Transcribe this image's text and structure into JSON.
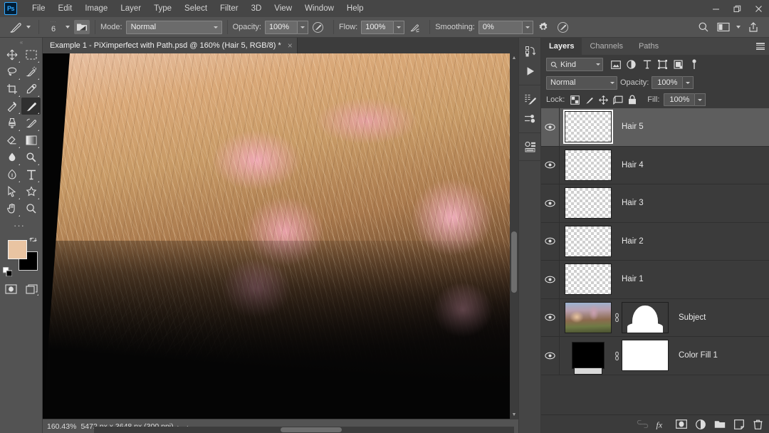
{
  "app": {
    "logo_text": "Ps",
    "menus": [
      "File",
      "Edit",
      "Image",
      "Layer",
      "Type",
      "Select",
      "Filter",
      "3D",
      "View",
      "Window",
      "Help"
    ],
    "window_controls": [
      {
        "name": "minimize-button",
        "glyph": "–"
      },
      {
        "name": "restore-button",
        "glyph": "❐"
      },
      {
        "name": "close-button",
        "glyph": "✕"
      }
    ]
  },
  "options_bar": {
    "brush_icon": "brush-tool-icon",
    "brush_size": "6",
    "size_dots": "···",
    "tool_preset_icon": "brush-preset-picker-icon",
    "mode_label": "Mode:",
    "mode_value": "Normal",
    "opacity_label": "Opacity:",
    "opacity_value": "100%",
    "pressure_opacity_icon": "pressure-controls-opacity-icon",
    "flow_label": "Flow:",
    "flow_value": "100%",
    "airbrush_icon": "airbrush-icon",
    "smoothing_label": "Smoothing:",
    "smoothing_value": "0%",
    "smoothing_options_icon": "gear-icon",
    "pressure_size_icon": "pressure-controls-size-icon",
    "search_icon": "search-icon",
    "workspace_icon": "workspace-switcher-icon",
    "share_icon": "share-icon"
  },
  "toolbar": {
    "handle": "«",
    "tools": [
      {
        "name": "move-tool",
        "active": false
      },
      {
        "name": "rectangular-marquee-tool",
        "active": false
      },
      {
        "name": "lasso-tool",
        "active": false
      },
      {
        "name": "quick-selection-tool",
        "active": false
      },
      {
        "name": "crop-tool",
        "active": false
      },
      {
        "name": "eyedropper-tool",
        "active": false
      },
      {
        "name": "healing-brush-tool",
        "active": false
      },
      {
        "name": "brush-tool",
        "active": true
      },
      {
        "name": "clone-stamp-tool",
        "active": false
      },
      {
        "name": "history-brush-tool",
        "active": false
      },
      {
        "name": "eraser-tool",
        "active": false
      },
      {
        "name": "gradient-tool",
        "active": false
      },
      {
        "name": "blur-tool",
        "active": false
      },
      {
        "name": "dodge-tool",
        "active": false
      },
      {
        "name": "pen-tool",
        "active": false
      },
      {
        "name": "horizontal-type-tool",
        "active": false
      },
      {
        "name": "path-selection-tool",
        "active": false
      },
      {
        "name": "custom-shape-tool",
        "active": false
      },
      {
        "name": "hand-tool",
        "active": false
      },
      {
        "name": "zoom-tool",
        "active": false
      }
    ],
    "more_tools": "···",
    "foreground_color": "#e9c4a2",
    "background_color": "#000000",
    "swap_icon": "swap-colors-icon",
    "default_colors_icon": "default-colors-icon",
    "quick_mask_icon": "quick-mask-icon",
    "screen_mode_icon": "screen-mode-icon"
  },
  "document": {
    "tab_title": "Example 1 - PiXimperfect with Path.psd @ 160% (Hair 5, RGB/8) *",
    "close_glyph": "×"
  },
  "status_bar": {
    "zoom": "160.43%",
    "dimensions": "5472 px x 3648 px (300 ppi)",
    "expand_glyph": "›",
    "collapse_glyph": "‹"
  },
  "icon_dock": {
    "icons": [
      {
        "name": "history-panel-icon"
      },
      {
        "name": "actions-play-icon"
      },
      {
        "name": "brush-settings-icon"
      },
      {
        "name": "brush-presets-icon"
      },
      {
        "name": "properties-panel-icon"
      }
    ]
  },
  "layers_panel": {
    "tabs": [
      {
        "label": "Layers",
        "active": true
      },
      {
        "label": "Channels",
        "active": false
      },
      {
        "label": "Paths",
        "active": false
      }
    ],
    "panel_menu_icon": "panel-menu-icon",
    "filter": {
      "search_icon": "search-icon",
      "kind_label": "Kind",
      "type_icons": [
        {
          "name": "filter-pixel-layers-icon"
        },
        {
          "name": "filter-adjustment-layers-icon"
        },
        {
          "name": "filter-type-layers-icon"
        },
        {
          "name": "filter-shape-layers-icon"
        },
        {
          "name": "filter-smart-object-layers-icon"
        }
      ],
      "toggle_icon": "filter-toggle-switch-icon"
    },
    "blend_mode": "Normal",
    "opacity_label": "Opacity:",
    "opacity_value": "100%",
    "lock_label": "Lock:",
    "lock_icons": [
      {
        "name": "lock-transparent-pixels-icon"
      },
      {
        "name": "lock-image-pixels-icon"
      },
      {
        "name": "lock-position-icon"
      },
      {
        "name": "lock-artboard-nesting-icon"
      },
      {
        "name": "lock-all-icon"
      }
    ],
    "fill_label": "Fill:",
    "fill_value": "100%",
    "layers": [
      {
        "name": "Hair 5",
        "selected": true,
        "thumb": "transparent",
        "mask": null
      },
      {
        "name": "Hair 4",
        "selected": false,
        "thumb": "transparent",
        "mask": null
      },
      {
        "name": "Hair 3",
        "selected": false,
        "thumb": "transparent",
        "mask": null
      },
      {
        "name": "Hair 2",
        "selected": false,
        "thumb": "transparent",
        "mask": null
      },
      {
        "name": "Hair 1",
        "selected": false,
        "thumb": "transparent",
        "mask": null
      },
      {
        "name": "Subject",
        "selected": false,
        "thumb": "photo",
        "mask": "silhouette"
      },
      {
        "name": "Color Fill 1",
        "selected": false,
        "thumb": "solid-black",
        "mask": "white"
      }
    ],
    "bottom_icons": [
      {
        "name": "link-layers-icon",
        "glyph": "link"
      },
      {
        "name": "layer-style-fx-icon",
        "glyph": "fx"
      },
      {
        "name": "add-layer-mask-icon",
        "glyph": "mask"
      },
      {
        "name": "new-adjustment-layer-icon",
        "glyph": "adjust"
      },
      {
        "name": "new-group-icon",
        "glyph": "folder"
      },
      {
        "name": "new-layer-icon",
        "glyph": "newlayer"
      },
      {
        "name": "delete-layer-icon",
        "glyph": "trash"
      }
    ]
  },
  "colors": {
    "chrome": "#535353",
    "panel": "#3b3b3b",
    "accent": "#31a8ff",
    "selected_row": "#5e5e5e"
  }
}
